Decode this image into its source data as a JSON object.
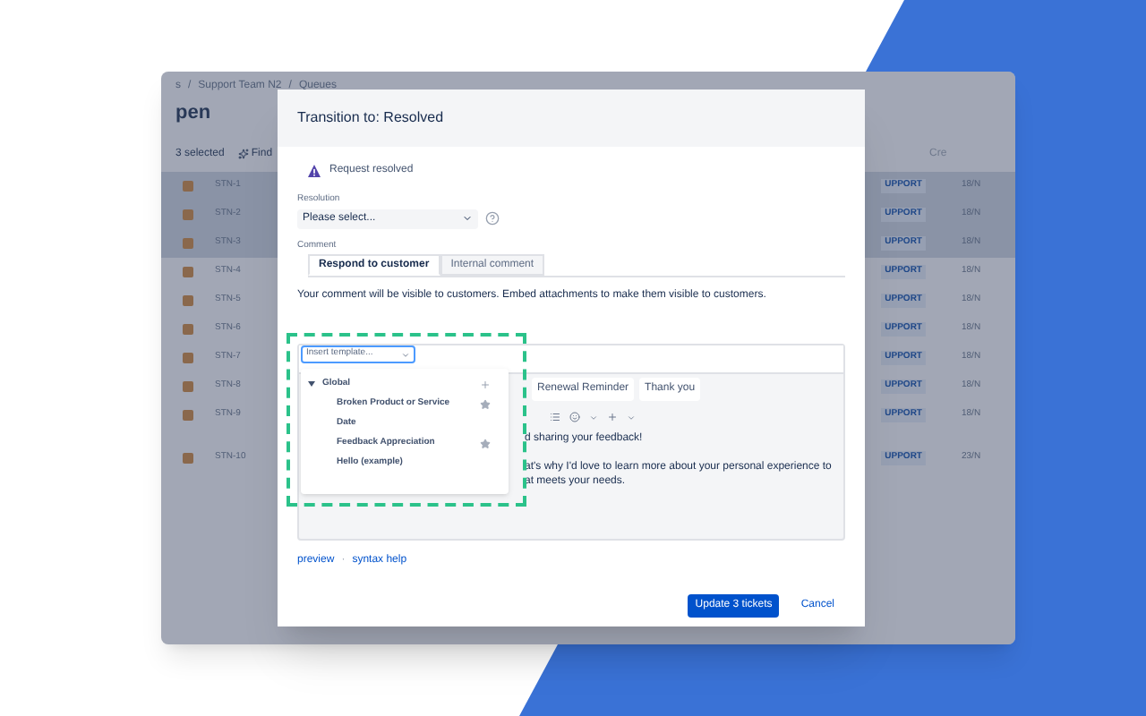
{
  "background_app": {
    "breadcrumb": [
      "s",
      "Support Team N2",
      "Queues"
    ],
    "breadcrumb_separator": "/",
    "title": "pen",
    "selected_count": "3 selected",
    "find_button": "Find",
    "column_header": "Cre",
    "rows": [
      {
        "key": "STN-1",
        "type": "UPPORT",
        "created": "18/N",
        "selected": true
      },
      {
        "key": "STN-2",
        "type": "UPPORT",
        "created": "18/N",
        "selected": true
      },
      {
        "key": "STN-3",
        "type": "UPPORT",
        "created": "18/N",
        "selected": true
      },
      {
        "key": "STN-4",
        "type": "UPPORT",
        "created": "18/N",
        "selected": false
      },
      {
        "key": "STN-5",
        "type": "UPPORT",
        "created": "18/N",
        "selected": false
      },
      {
        "key": "STN-6",
        "type": "UPPORT",
        "created": "18/N",
        "selected": false
      },
      {
        "key": "STN-7",
        "type": "UPPORT",
        "created": "18/N",
        "selected": false
      },
      {
        "key": "STN-8",
        "type": "UPPORT",
        "created": "18/N",
        "selected": false
      },
      {
        "key": "STN-9",
        "type": "UPPORT",
        "created": "18/N",
        "selected": false
      },
      {
        "key": "STN-10",
        "type": "UPPORT",
        "created": "23/N",
        "selected": false
      }
    ]
  },
  "dialog": {
    "title": "Transition to: Resolved",
    "status": "Request resolved",
    "resolution": {
      "label": "Resolution",
      "value": "Please select..."
    },
    "comment": {
      "label": "Comment",
      "tabs": [
        {
          "label": "Respond to customer",
          "selected": true
        },
        {
          "label": "Internal comment",
          "selected": false
        }
      ],
      "note": "Your comment will be visible to customers. Embed attachments to make them visible to customers."
    },
    "editor": {
      "template_tabs": [
        "Renewal Reminder",
        "Thank you"
      ],
      "body": [
        "d sharing your feedback!",
        "at's why I'd love to learn more about your personal experience to",
        "at meets your needs."
      ]
    },
    "template_menu": {
      "button": "Insert template...",
      "groups": [
        {
          "label": "Global",
          "expanded": true,
          "items": [
            {
              "label": "Broken Product or Service",
              "starred": true
            },
            {
              "label": "Date",
              "starred": false
            },
            {
              "label": "Feedback Appreciation",
              "starred": true
            },
            {
              "label": "Hello (example)",
              "starred": false
            }
          ]
        }
      ]
    },
    "links": [
      "preview",
      "syntax help"
    ],
    "link_separator": "·",
    "buttons": [
      {
        "label": "Update 3 tickets",
        "kind": "primary"
      },
      {
        "label": "Cancel",
        "kind": "link"
      }
    ]
  }
}
